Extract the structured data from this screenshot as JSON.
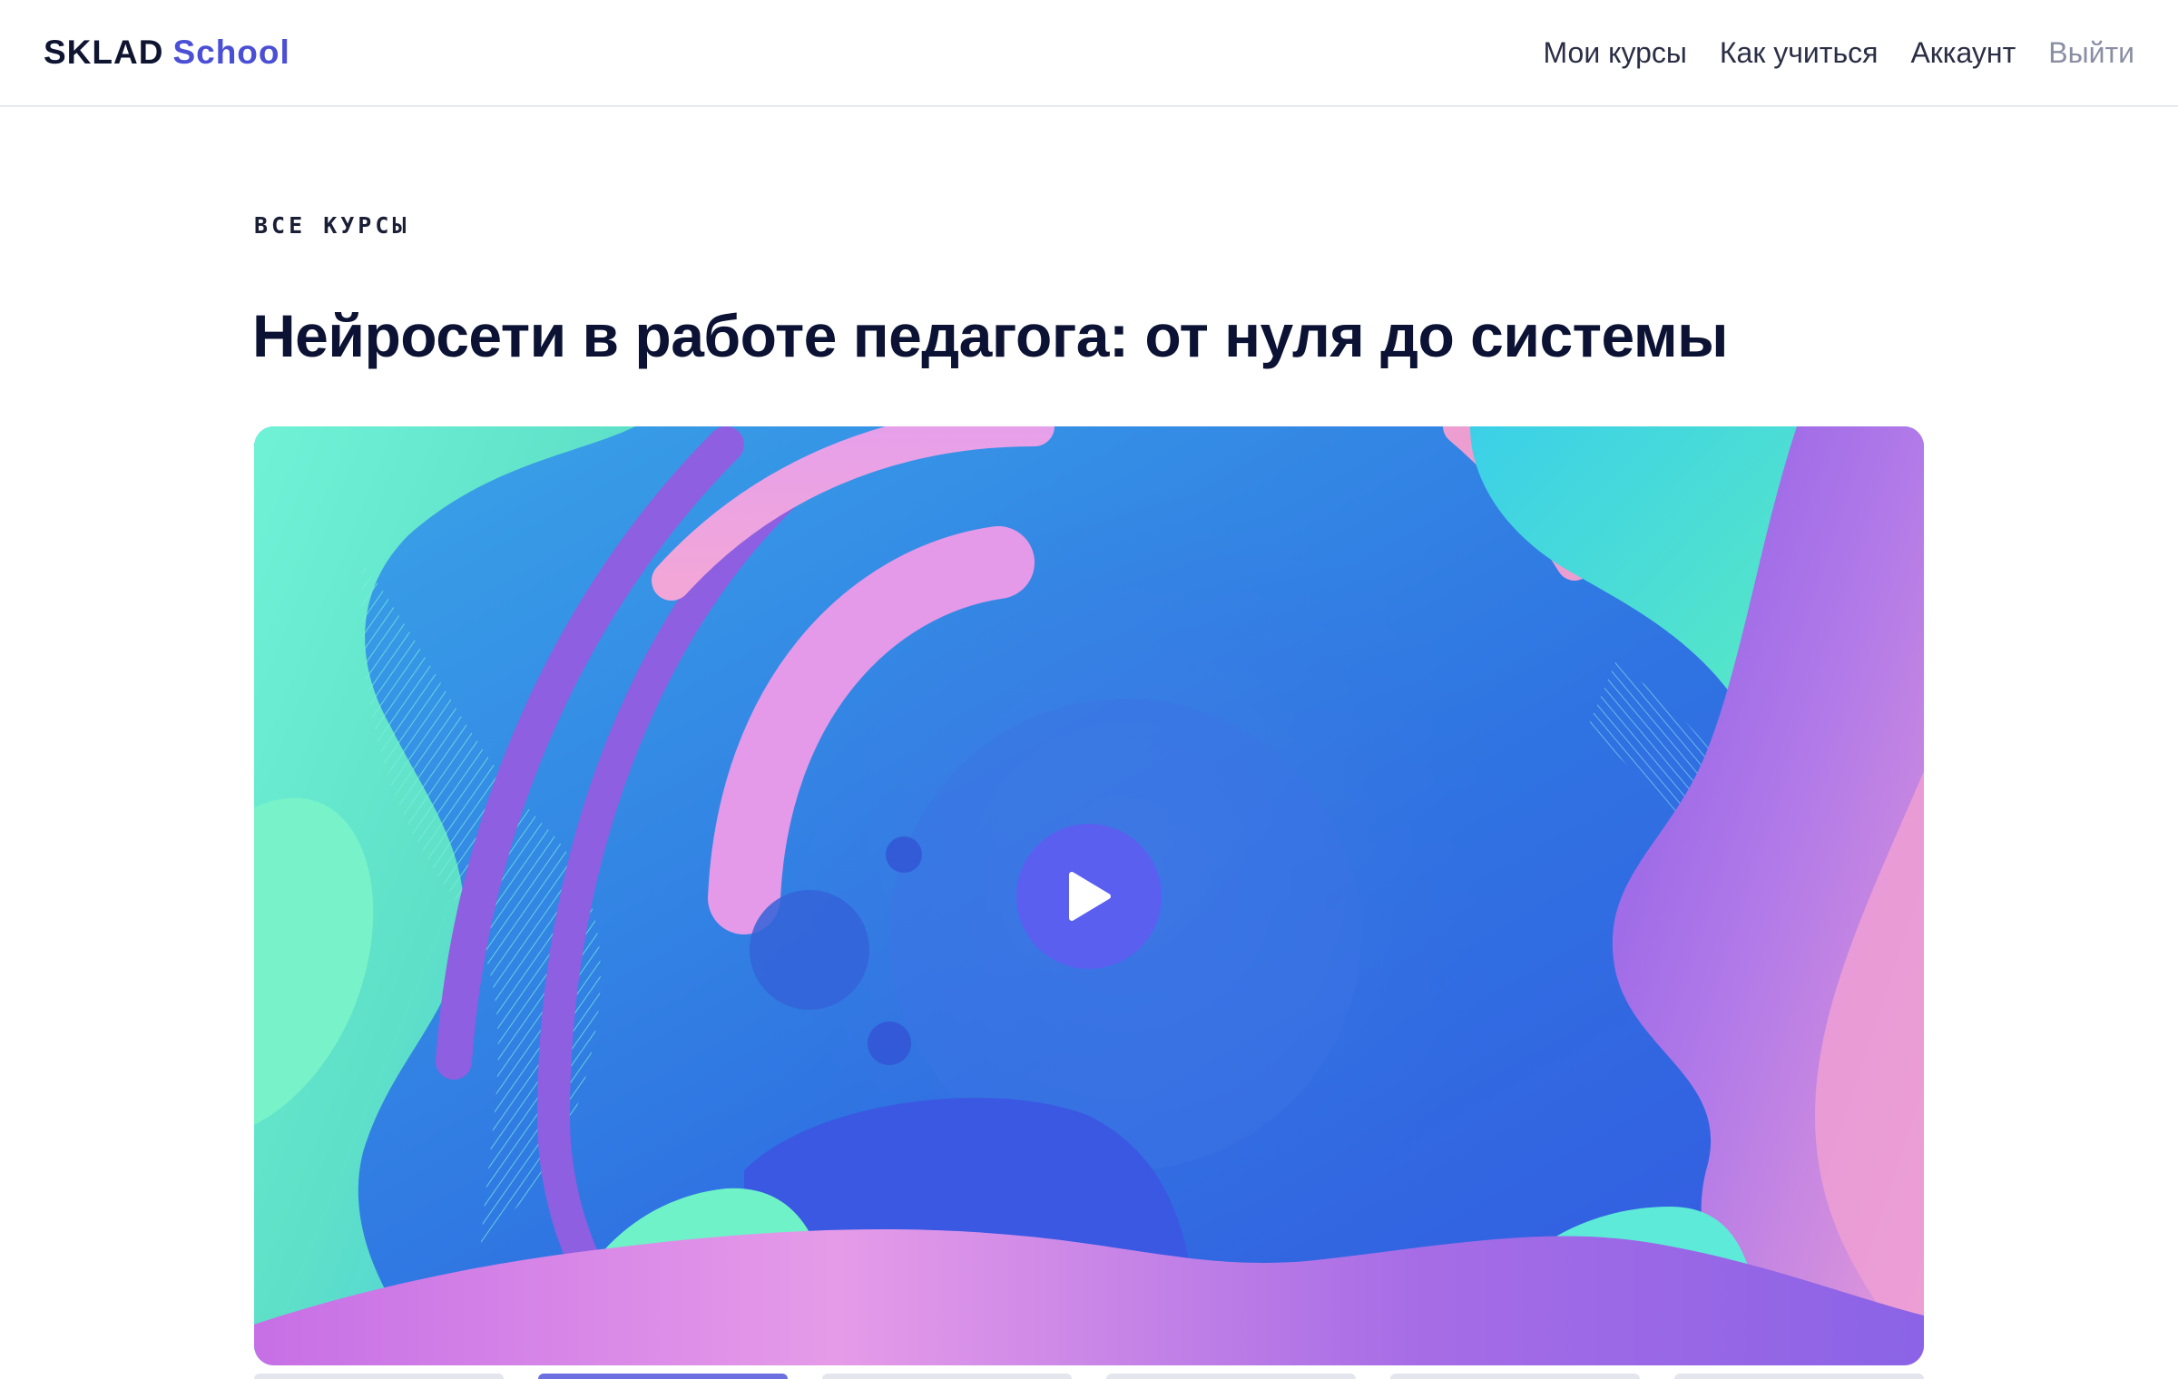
{
  "header": {
    "brand": "SKLAD",
    "brand_accent": "School",
    "nav": [
      {
        "label": "Мои курсы"
      },
      {
        "label": "Как учиться"
      },
      {
        "label": "Аккаунт"
      },
      {
        "label": "Выйти"
      }
    ]
  },
  "breadcrumb": "ВСЕ КУРСЫ",
  "course": {
    "title": "Нейросети в работе педагога: от нуля до системы"
  },
  "video": {
    "icon": "play-icon"
  },
  "colors": {
    "accent": "#4b4fd6",
    "play_button": "#5a5ff0",
    "title": "#0b1233",
    "muted_nav": "#8a8ea3"
  }
}
